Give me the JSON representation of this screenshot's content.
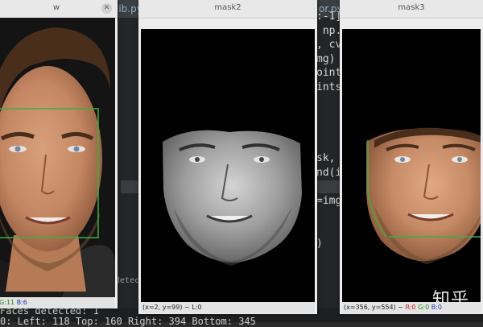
{
  "ide": {
    "tab_left": "lib.py",
    "tab_right": "or.py",
    "code_right": [
      ":-1]",
      " np.",
      ", cv",
      "mg)",
      "oint",
      "ints",
      "",
      "",
      "",
      "",
      "sk,",
      "nd(i",
      "",
      "=img",
      "",
      "",
      ")"
    ],
    "console_text": "detect_m",
    "console_faces": "Faces detected: 1",
    "console_coords": "0: Left: 118 Top: 160 Right: 394 Bottom: 345"
  },
  "windows": [
    {
      "title": "w",
      "status": {
        "prefix": "",
        "r": "",
        "g": "G:11",
        "b": "B:6"
      }
    },
    {
      "title": "mask2",
      "status": {
        "prefix": "(x=2, y=99) ~ L:0",
        "r": "",
        "g": "",
        "b": ""
      }
    },
    {
      "title": "mask3",
      "status": {
        "prefix": "(x=356, y=554) ~ ",
        "r": "R:0",
        "g": "G:0",
        "b": "B:0"
      }
    }
  ],
  "watermark": "知乎 @",
  "colors": {
    "detection_box": "#3fae3f",
    "hull_line": "#3fae3f",
    "skin": "#c58a66",
    "hair": "#4a2e1c"
  }
}
